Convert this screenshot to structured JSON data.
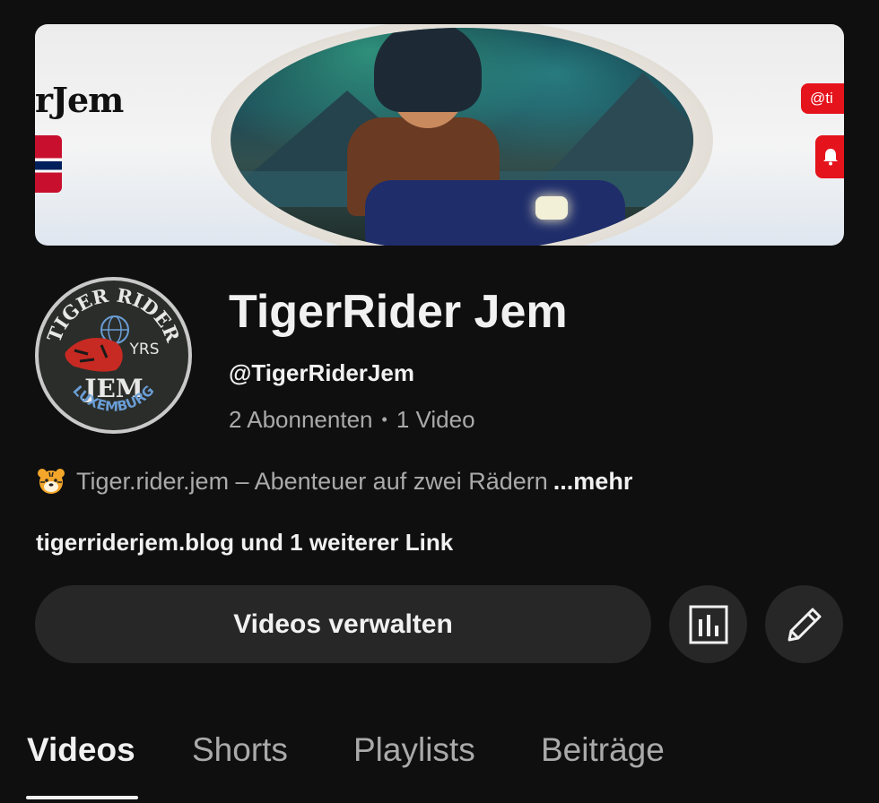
{
  "banner": {
    "text": "rJem",
    "badge_text": "@ti"
  },
  "avatar": {
    "top_text": "TIGER RIDER",
    "side_text": "YRS",
    "middle_text": "JEM",
    "bottom_text": "LUXEMBURG"
  },
  "channel": {
    "name": "TigerRider Jem",
    "handle": "@TigerRiderJem",
    "subscribers": "2 Abonnenten",
    "separator": "•",
    "videos": "1 Video"
  },
  "description": {
    "text": "Tiger.rider.jem – Abenteuer auf zwei Rädern",
    "more_label": "...mehr"
  },
  "links": {
    "text": "tigerriderjem.blog und 1 weiterer Link"
  },
  "actions": {
    "manage_videos_label": "Videos verwalten",
    "stats_icon": "analytics-icon",
    "edit_icon": "pencil-icon"
  },
  "tabs": [
    {
      "label": "Videos",
      "active": true
    },
    {
      "label": "Shorts",
      "active": false
    },
    {
      "label": "Playlists",
      "active": false
    },
    {
      "label": "Beiträge",
      "active": false
    }
  ],
  "colors": {
    "background": "#0f0f0f",
    "button_bg": "#272727",
    "secondary_text": "#aaaaaa",
    "primary_text": "#f1f1f1",
    "banner_red": "#e4131c"
  }
}
